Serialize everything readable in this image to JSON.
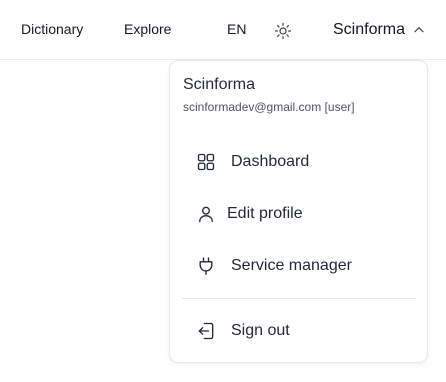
{
  "nav": {
    "dictionary": "Dictionary",
    "explore": "Explore",
    "language": "EN",
    "theme_icon": "sun-icon"
  },
  "user": {
    "name": "Scinforma",
    "chevron_icon": "chevron-up-icon"
  },
  "dropdown": {
    "name": "Scinforma",
    "email": "scinformadev@gmail.com [user]",
    "items": [
      {
        "label": "Dashboard",
        "icon": "grid-icon"
      },
      {
        "label": "Edit profile",
        "icon": "user-icon"
      },
      {
        "label": "Service manager",
        "icon": "plug-icon"
      },
      {
        "label": "Sign out",
        "icon": "sign-out-icon"
      }
    ]
  },
  "colors": {
    "text": "#1f2937",
    "border": "#e5e7eb"
  }
}
